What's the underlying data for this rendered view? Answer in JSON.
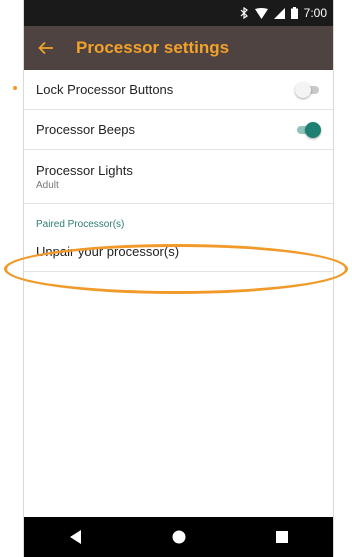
{
  "status_bar": {
    "time": "7:00",
    "icons": [
      "bluetooth-icon",
      "wifi-icon",
      "signal-icon",
      "battery-icon"
    ]
  },
  "app_bar": {
    "title": "Processor settings",
    "back_icon": "back-arrow-icon"
  },
  "settings": {
    "lock_buttons": {
      "label": "Lock Processor Buttons",
      "enabled": false
    },
    "beeps": {
      "label": "Processor Beeps",
      "enabled": true
    },
    "lights": {
      "label": "Processor Lights",
      "value": "Adult"
    },
    "paired_header": "Paired Processor(s)",
    "unpair": {
      "label": "Unpair your processor(s)"
    }
  },
  "nav_bar": {
    "buttons": [
      "back-triangle-icon",
      "home-circle-icon",
      "recents-square-icon"
    ]
  },
  "colors": {
    "app_bar_bg": "#4e4340",
    "title": "#f2a12a",
    "accent_teal": "#1e8073",
    "highlight_orange": "#f19a2a"
  }
}
